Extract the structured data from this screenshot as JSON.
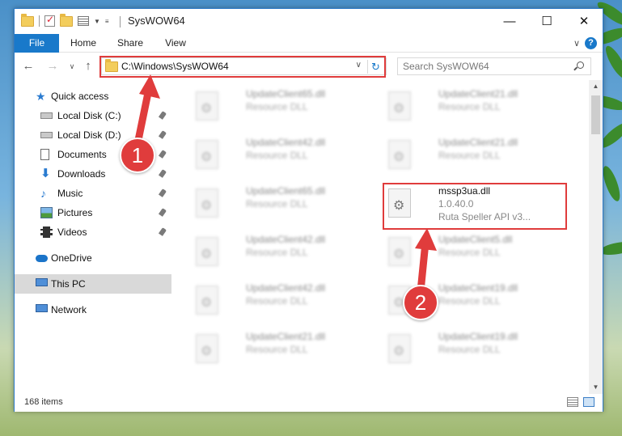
{
  "window": {
    "title": "SysWOW64"
  },
  "ribbon": {
    "tabs": [
      "File",
      "Home",
      "Share",
      "View"
    ],
    "help_label": "?"
  },
  "nav": {
    "address": "C:\\Windows\\SysWOW64",
    "search_placeholder": "Search SysWOW64"
  },
  "sidebar": {
    "quick_access": "Quick access",
    "items": [
      {
        "label": "Local Disk (C:)",
        "icon": "drive-icon",
        "pinned": true
      },
      {
        "label": "Local Disk (D:)",
        "icon": "drive-icon",
        "pinned": true
      },
      {
        "label": "Documents",
        "icon": "documents-icon",
        "pinned": true
      },
      {
        "label": "Downloads",
        "icon": "downloads-icon",
        "pinned": true
      },
      {
        "label": "Music",
        "icon": "music-icon",
        "pinned": true
      },
      {
        "label": "Pictures",
        "icon": "pictures-icon",
        "pinned": true
      },
      {
        "label": "Videos",
        "icon": "videos-icon",
        "pinned": true
      }
    ],
    "onedrive": "OneDrive",
    "this_pc": "This PC",
    "network": "Network"
  },
  "files": {
    "left": [
      {
        "name": "UpdateClient65.dll",
        "type": "Resource DLL"
      },
      {
        "name": "UpdateClient42.dll",
        "type": "Resource DLL"
      },
      {
        "name": "UpdateClient65.dll",
        "type": "Resource DLL"
      },
      {
        "name": "UpdateClient42.dll",
        "type": "Resource DLL"
      },
      {
        "name": "UpdateClient42.dll",
        "type": "Resource DLL"
      },
      {
        "name": "UpdateClient21.dll",
        "type": "Resource DLL"
      }
    ],
    "right": [
      {
        "name": "UpdateClient21.dll",
        "type": "Resource DLL"
      },
      {
        "name": "UpdateClient21.dll",
        "type": "Resource DLL"
      },
      {
        "name": "mssp3ua.dll",
        "version": "1.0.40.0",
        "description": "Ruta Speller API v3..."
      },
      {
        "name": "UpdateClient5.dll",
        "type": "Resource DLL"
      },
      {
        "name": "UpdateClient19.dll",
        "type": "Resource DLL"
      },
      {
        "name": "UpdateClient19.dll",
        "type": "Resource DLL"
      }
    ]
  },
  "status": {
    "count": "168 items"
  },
  "annotations": {
    "step1": "1",
    "step2": "2"
  },
  "colors": {
    "accent": "#1979ca",
    "highlight": "#e03c3c",
    "selected": "#d9d9d9"
  }
}
